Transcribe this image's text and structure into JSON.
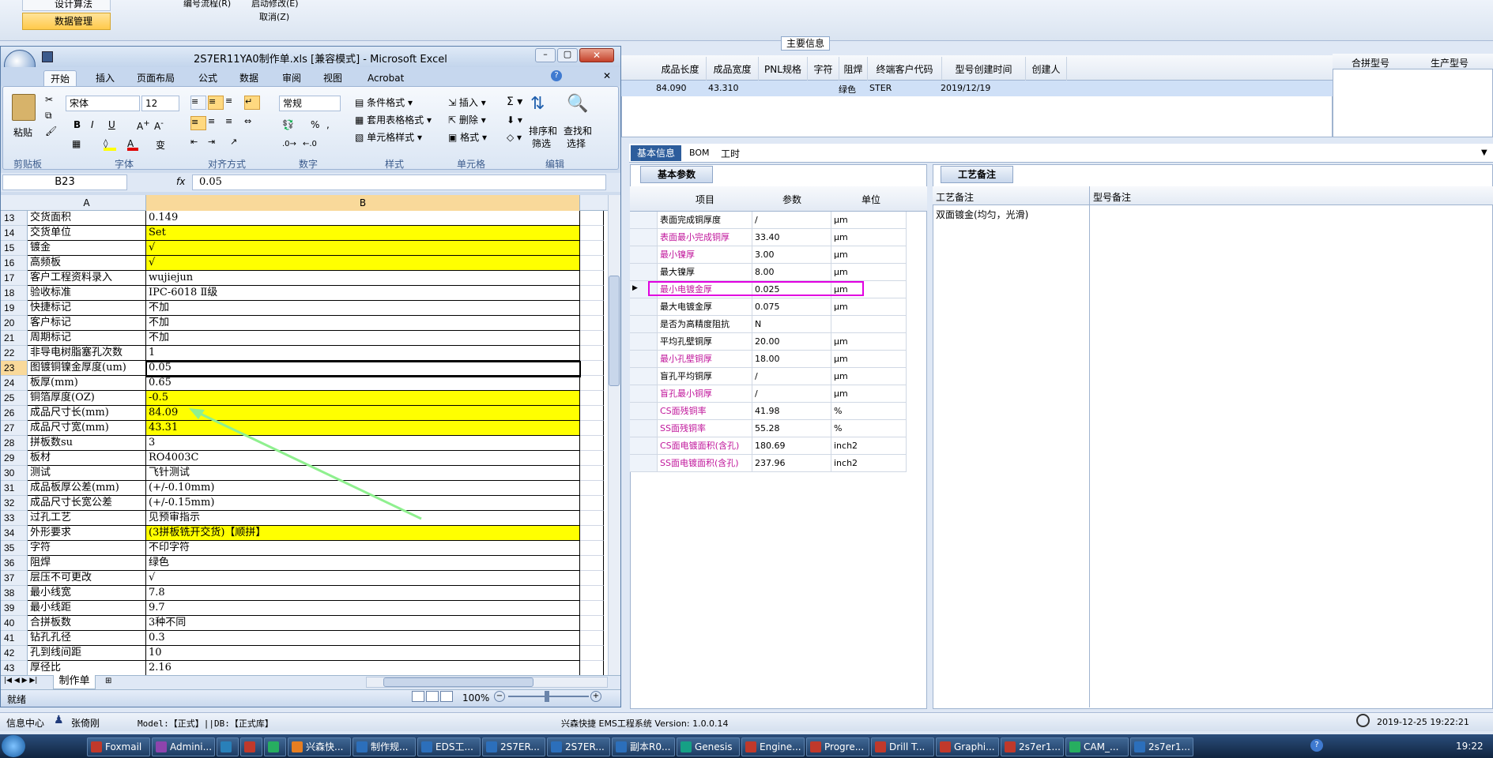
{
  "bg_app": {
    "sidebar": {
      "items": [
        "设计算法",
        "数据管理"
      ]
    },
    "toolbar": {
      "item1": "编号流程(R)",
      "item2": "启动修改(E)",
      "item3": "取消(Z)"
    },
    "main_info_label": "主要信息",
    "top_table": {
      "headers": [
        "成品长度",
        "成品宽度",
        "PNL规格",
        "字符",
        "阻焊",
        "终端客户代码",
        "型号创建时间",
        "创建人"
      ],
      "row": [
        "84.090",
        "43.310",
        "",
        "",
        "绿色",
        "STER",
        "2019/12/19",
        ""
      ],
      "right_headers": [
        "合拼型号",
        "生产型号"
      ]
    },
    "tabs": [
      "基本信息",
      "BOM",
      "工时"
    ],
    "sub_tab": "基本参数",
    "param_headers": [
      "项目",
      "参数",
      "单位"
    ],
    "params": [
      {
        "name": "表面完成铜厚度",
        "value": "/",
        "unit": "μm",
        "pink": false
      },
      {
        "name": "表面最小完成铜厚",
        "value": "33.40",
        "unit": "μm",
        "pink": true
      },
      {
        "name": "最小镍厚",
        "value": "3.00",
        "unit": "μm",
        "pink": true
      },
      {
        "name": "最大镍厚",
        "value": "8.00",
        "unit": "μm",
        "pink": false
      },
      {
        "name": "最小电镀金厚",
        "value": "0.025",
        "unit": "μm",
        "pink": true
      },
      {
        "name": "最大电镀金厚",
        "value": "0.075",
        "unit": "μm",
        "pink": false
      },
      {
        "name": "是否为高精度阻抗",
        "value": "N",
        "unit": "",
        "pink": false
      },
      {
        "name": "平均孔壁铜厚",
        "value": "20.00",
        "unit": "μm",
        "pink": false
      },
      {
        "name": "最小孔壁铜厚",
        "value": "18.00",
        "unit": "μm",
        "pink": true
      },
      {
        "name": "盲孔平均铜厚",
        "value": "/",
        "unit": "μm",
        "pink": false
      },
      {
        "name": "盲孔最小铜厚",
        "value": "/",
        "unit": "μm",
        "pink": true
      },
      {
        "name": "CS面残铜率",
        "value": "41.98",
        "unit": "%",
        "pink": true
      },
      {
        "name": "SS面残铜率",
        "value": "55.28",
        "unit": "%",
        "pink": true
      },
      {
        "name": "CS面电镀面积(含孔)",
        "value": "180.69",
        "unit": "inch2",
        "pink": true
      },
      {
        "name": "SS面电镀面积(含孔)",
        "value": "237.96",
        "unit": "inch2",
        "pink": true
      }
    ],
    "craft_tab": "工艺备注",
    "craft_headers": [
      "工艺备注",
      "型号备注"
    ],
    "craft_note": "双面镀金(均匀，光滑)",
    "status": {
      "info": "信息中心",
      "user": "张倚刚",
      "model": "Model:【正式】||DB:【正式库】",
      "system": "兴森快捷 EMS工程系统 Version: 1.0.0.14",
      "datetime": "2019-12-25 19:22:21"
    }
  },
  "excel": {
    "title": "2S7ER11YA0制作单.xls [兼容模式] - Microsoft Excel",
    "ribbon_tabs": [
      "开始",
      "插入",
      "页面布局",
      "公式",
      "数据",
      "审阅",
      "视图",
      "Acrobat"
    ],
    "font_name": "宋体",
    "font_size": "12",
    "number_format": "常规",
    "groups": [
      "剪贴板",
      "字体",
      "对齐方式",
      "数字",
      "样式",
      "单元格",
      "编辑"
    ],
    "btn": {
      "paste": "粘贴",
      "cond": "条件格式",
      "table": "套用表格格式",
      "cellstyle": "单元格样式",
      "insert": "插入",
      "delete": "删除",
      "format": "格式",
      "sort": "排序和\n筛选",
      "find": "查找和\n选择",
      "sort1": "排序和",
      "sort2": "筛选",
      "find1": "查找和",
      "find2": "选择"
    },
    "name_box": "B23",
    "fx": "fx",
    "formula": "0.05",
    "col_a": "A",
    "col_b": "B",
    "rows": [
      {
        "n": "13",
        "a": "交货面积",
        "b": "0.149",
        "y": false
      },
      {
        "n": "14",
        "a": "交货单位",
        "b": "Set",
        "y": true
      },
      {
        "n": "15",
        "a": "镀金",
        "b": "√",
        "y": true
      },
      {
        "n": "16",
        "a": "高频板",
        "b": "√",
        "y": true
      },
      {
        "n": "17",
        "a": "客户工程资料录入",
        "b": "wujiejun",
        "y": false
      },
      {
        "n": "18",
        "a": "验收标准",
        "b": "IPC-6018 Ⅱ级",
        "y": false
      },
      {
        "n": "19",
        "a": "快捷标记",
        "b": "不加",
        "y": false
      },
      {
        "n": "20",
        "a": "客户标记",
        "b": "不加",
        "y": false
      },
      {
        "n": "21",
        "a": "周期标记",
        "b": "不加",
        "y": false
      },
      {
        "n": "22",
        "a": "非导电树脂塞孔次数",
        "b": "1",
        "y": false
      },
      {
        "n": "23",
        "a": "图镀铜镍金厚度(um)",
        "b": "0.05",
        "y": false
      },
      {
        "n": "24",
        "a": "板厚(mm)",
        "b": "0.65",
        "y": false
      },
      {
        "n": "25",
        "a": "铜箔厚度(OZ)",
        "b": "-0.5",
        "y": true
      },
      {
        "n": "26",
        "a": "成品尺寸长(mm)",
        "b": "84.09",
        "y": true
      },
      {
        "n": "27",
        "a": "成品尺寸宽(mm)",
        "b": "43.31",
        "y": true
      },
      {
        "n": "28",
        "a": "拼板数su",
        "b": "3",
        "y": false
      },
      {
        "n": "29",
        "a": "板材",
        "b": "RO4003C",
        "y": false
      },
      {
        "n": "30",
        "a": "测试",
        "b": "飞针测试",
        "y": false
      },
      {
        "n": "31",
        "a": "成品板厚公差(mm)",
        "b": "(+/-0.10mm)",
        "y": false
      },
      {
        "n": "32",
        "a": "成品尺寸长宽公差",
        "b": "(+/-0.15mm)",
        "y": false
      },
      {
        "n": "33",
        "a": "过孔工艺",
        "b": "见预审指示",
        "y": false
      },
      {
        "n": "34",
        "a": "外形要求",
        "b": "(3拼板铣开交货)【顺拼】",
        "y": true
      },
      {
        "n": "35",
        "a": "字符",
        "b": "不印字符",
        "y": false
      },
      {
        "n": "36",
        "a": "阻焊",
        "b": "绿色",
        "y": false
      },
      {
        "n": "37",
        "a": "层压不可更改",
        "b": "√",
        "y": false
      },
      {
        "n": "38",
        "a": "最小线宽",
        "b": "7.8",
        "y": false
      },
      {
        "n": "39",
        "a": "最小线距",
        "b": "9.7",
        "y": false
      },
      {
        "n": "40",
        "a": "合拼板数",
        "b": "3种不同",
        "y": false
      },
      {
        "n": "41",
        "a": "钻孔孔径",
        "b": "0.3",
        "y": false
      },
      {
        "n": "42",
        "a": "孔到线间距",
        "b": "10",
        "y": false
      },
      {
        "n": "43",
        "a": "厚径比",
        "b": "2.16",
        "y": false
      }
    ],
    "sheet_tab": "制作单",
    "status": "就绪",
    "zoom": "100%"
  },
  "taskbar": {
    "items": [
      "Foxmail",
      "Admini...",
      "",
      "",
      "",
      "兴森快...",
      "制作规...",
      "EDS工...",
      "2S7ER...",
      "2S7ER...",
      "副本R0...",
      "Genesis",
      "Engine...",
      "Progre...",
      "Drill T...",
      "Graphi...",
      "2s7er1...",
      "CAM_...",
      "2s7er1..."
    ],
    "time": "19:22"
  },
  "colors": {
    "highlight": "#e100e1",
    "arrow": "#8ff08f",
    "yellow": "#ffff00",
    "pink": "#c0169b"
  }
}
